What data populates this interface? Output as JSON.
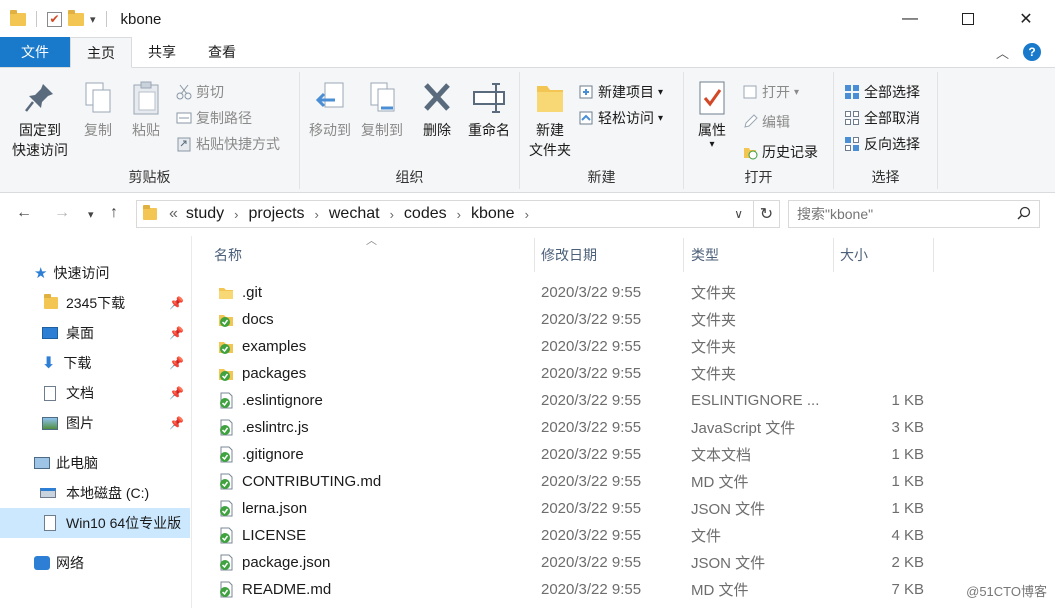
{
  "window": {
    "title": "kbone"
  },
  "ribbon_tabs": [
    "文件",
    "主页",
    "共享",
    "查看"
  ],
  "ribbon": {
    "clipboard": {
      "label": "剪贴板",
      "pin_line1": "固定到",
      "pin_line2": "快速访问",
      "copy": "复制",
      "paste": "粘贴",
      "cut": "剪切",
      "copy_path": "复制路径",
      "paste_shortcut": "粘贴快捷方式"
    },
    "organize": {
      "label": "组织",
      "move_to": "移动到",
      "copy_to": "复制到",
      "delete": "删除",
      "rename": "重命名"
    },
    "new": {
      "label": "新建",
      "new_folder_line1": "新建",
      "new_folder_line2": "文件夹",
      "new_item": "新建项目",
      "easy_access": "轻松访问"
    },
    "open": {
      "label": "打开",
      "properties": "属性",
      "open": "打开",
      "edit": "编辑",
      "history": "历史记录"
    },
    "select": {
      "label": "选择",
      "select_all": "全部选择",
      "select_none": "全部取消",
      "invert": "反向选择"
    }
  },
  "address": {
    "prefix": "«",
    "crumbs": [
      "study",
      "projects",
      "wechat",
      "codes",
      "kbone"
    ]
  },
  "search": {
    "placeholder": "搜索\"kbone\""
  },
  "sidebar": {
    "items": [
      {
        "label": "快速访问",
        "icon": "star-icon"
      },
      {
        "label": "2345下载",
        "icon": "folder-icon",
        "pinned": true
      },
      {
        "label": "桌面",
        "icon": "desktop-icon",
        "pinned": true
      },
      {
        "label": "下载",
        "icon": "download-icon",
        "pinned": true
      },
      {
        "label": "文档",
        "icon": "document-icon",
        "pinned": true
      },
      {
        "label": "图片",
        "icon": "picture-icon",
        "pinned": true
      },
      {
        "label": "此电脑",
        "icon": "computer-icon"
      },
      {
        "label": "本地磁盘 (C:)",
        "icon": "drive-icon"
      },
      {
        "label": "Win10 64位专业版",
        "icon": "disc-icon",
        "selected": true
      },
      {
        "label": "网络",
        "icon": "network-icon"
      }
    ]
  },
  "columns": {
    "name": "名称",
    "date": "修改日期",
    "type": "类型",
    "size": "大小"
  },
  "files": [
    {
      "name": ".git",
      "date": "2020/3/22 9:55",
      "type": "文件夹",
      "size": "",
      "icon": "folder-icon"
    },
    {
      "name": "docs",
      "date": "2020/3/22 9:55",
      "type": "文件夹",
      "size": "",
      "icon": "synced-folder-icon"
    },
    {
      "name": "examples",
      "date": "2020/3/22 9:55",
      "type": "文件夹",
      "size": "",
      "icon": "synced-folder-icon"
    },
    {
      "name": "packages",
      "date": "2020/3/22 9:55",
      "type": "文件夹",
      "size": "",
      "icon": "synced-folder-icon"
    },
    {
      "name": ".eslintignore",
      "date": "2020/3/22 9:55",
      "type": "ESLINTIGNORE ...",
      "size": "1 KB",
      "icon": "synced-file-icon"
    },
    {
      "name": ".eslintrc.js",
      "date": "2020/3/22 9:55",
      "type": "JavaScript 文件",
      "size": "3 KB",
      "icon": "synced-file-icon"
    },
    {
      "name": ".gitignore",
      "date": "2020/3/22 9:55",
      "type": "文本文档",
      "size": "1 KB",
      "icon": "synced-file-icon"
    },
    {
      "name": "CONTRIBUTING.md",
      "date": "2020/3/22 9:55",
      "type": "MD 文件",
      "size": "1 KB",
      "icon": "synced-file-icon"
    },
    {
      "name": "lerna.json",
      "date": "2020/3/22 9:55",
      "type": "JSON 文件",
      "size": "1 KB",
      "icon": "synced-file-icon"
    },
    {
      "name": "LICENSE",
      "date": "2020/3/22 9:55",
      "type": "文件",
      "size": "4 KB",
      "icon": "synced-file-icon"
    },
    {
      "name": "package.json",
      "date": "2020/3/22 9:55",
      "type": "JSON 文件",
      "size": "2 KB",
      "icon": "synced-file-icon"
    },
    {
      "name": "README.md",
      "date": "2020/3/22 9:55",
      "type": "MD 文件",
      "size": "7 KB",
      "icon": "synced-file-icon"
    }
  ],
  "watermark": "@51CTO博客"
}
